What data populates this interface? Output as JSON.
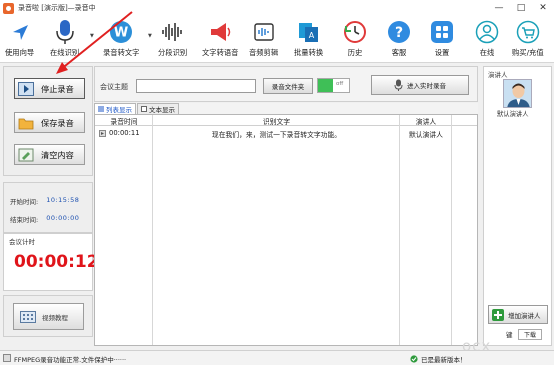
{
  "window": {
    "title": "录音啦 [演示版]—录音中"
  },
  "toolbar": [
    {
      "label": "使用向导",
      "icon": "navigate-arrow-icon",
      "dropdown": false
    },
    {
      "label": "在线识别",
      "icon": "microphone-icon",
      "dropdown": true
    },
    {
      "label": "录音转文字",
      "icon": "record-to-text-icon",
      "dropdown": true
    },
    {
      "label": "分段识别",
      "icon": "waveform-icon",
      "dropdown": false
    },
    {
      "label": "文字转语音",
      "icon": "megaphone-icon",
      "dropdown": false
    },
    {
      "label": "音频剪辑",
      "icon": "audio-edit-icon",
      "dropdown": false
    },
    {
      "label": "批量转换",
      "icon": "batch-convert-icon",
      "dropdown": false
    },
    {
      "label": "历史",
      "icon": "history-clock-icon",
      "dropdown": false
    },
    {
      "label": "客服",
      "icon": "help-question-icon",
      "dropdown": false
    },
    {
      "label": "设置",
      "icon": "settings-grid-icon",
      "dropdown": false
    },
    {
      "label": "在线",
      "icon": "online-user-icon",
      "dropdown": false
    },
    {
      "label": "购买/充值",
      "icon": "cart-icon",
      "dropdown": false
    }
  ],
  "left": {
    "stop_label": "停止录音",
    "save_label": "保存录音",
    "clear_label": "清空内容",
    "start_time_label": "开始时间:",
    "start_time": "10:15:58",
    "end_time_label": "结束时间:",
    "end_time": "00:00:00",
    "meeting_timer_label": "会议计时",
    "meeting_timer": "00:00:12",
    "tutorial_label": "视频教程"
  },
  "center": {
    "topic_label": "会议主题",
    "topic_value": "",
    "folder_button": "录音文件夹",
    "toggle_text": "off",
    "realtime_button": "进入实时录音",
    "tabs": [
      {
        "label": "列表显示",
        "selected": true
      },
      {
        "label": "文本显示",
        "selected": false
      }
    ],
    "columns": [
      "录音时间",
      "识别文字",
      "演讲人"
    ],
    "rows": [
      {
        "time": "00:00:11",
        "text": "现在我们，来，测试一下录音转文字功能。",
        "speaker": "默认演讲人"
      }
    ]
  },
  "right": {
    "caption": "演讲人",
    "speaker_name": "默认演讲人",
    "add_speaker_button": "增加演讲人",
    "download_label": "下载",
    "download_prefix": "键"
  },
  "status": {
    "message": "FFMPEG录音功能正常.文件保护中······",
    "version_text": "已是最新版本！"
  },
  "watermark": "ocx"
}
